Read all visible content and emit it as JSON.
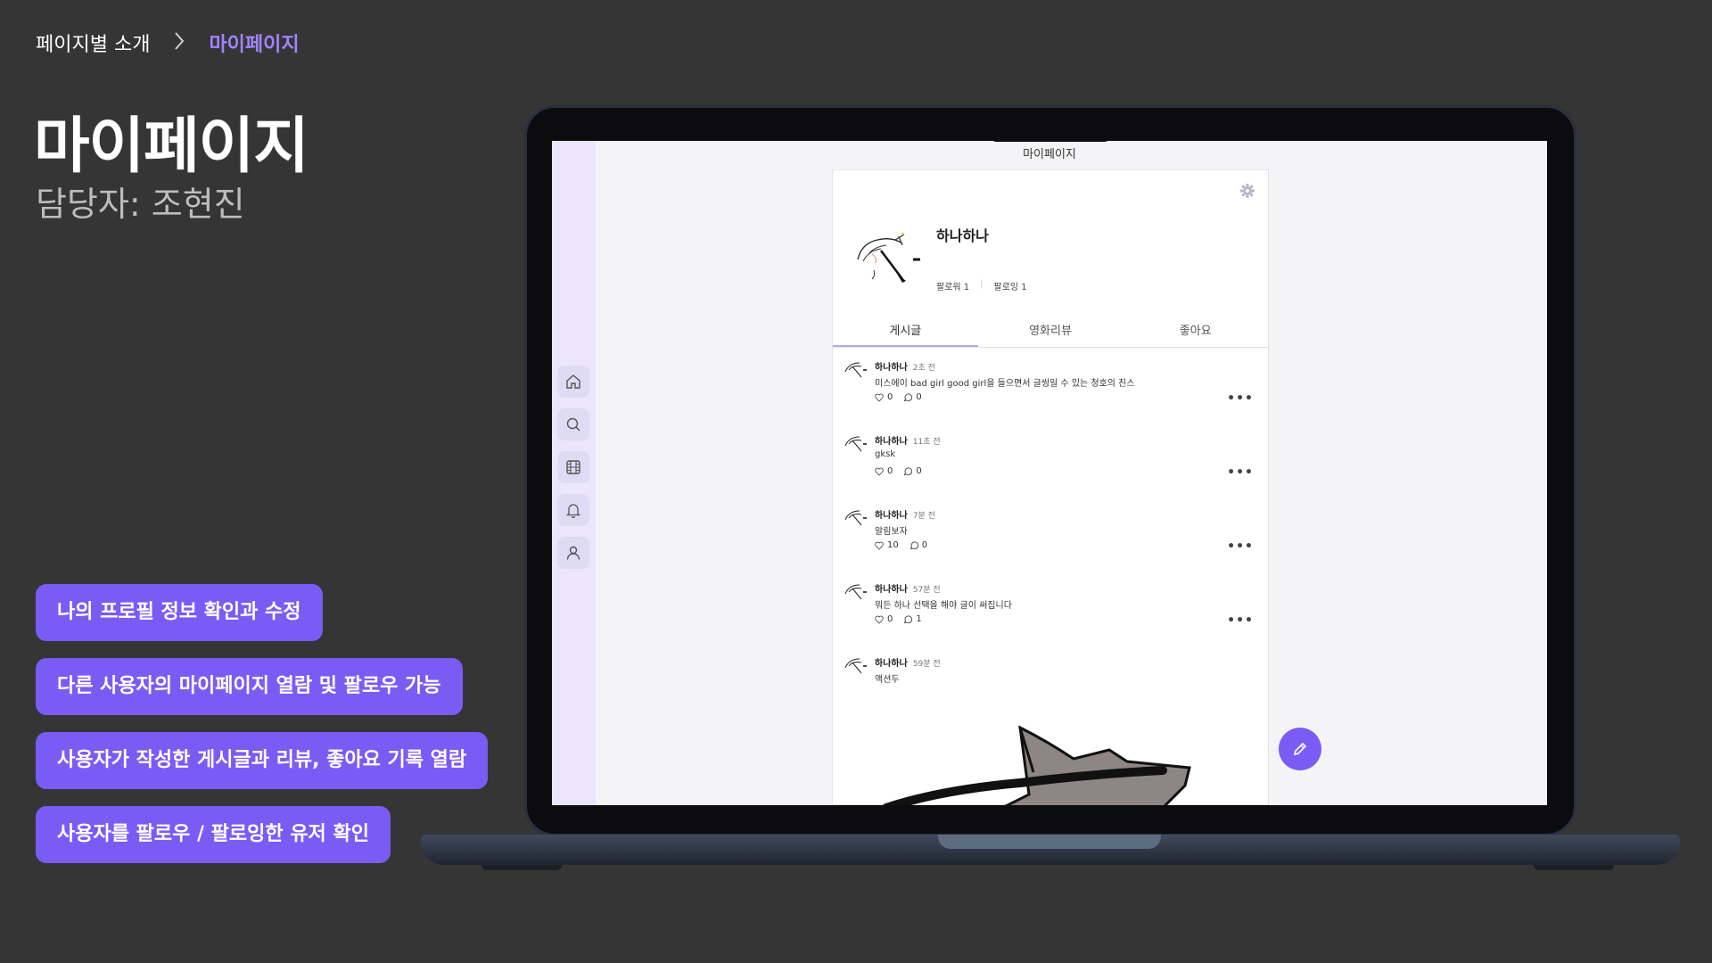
{
  "breadcrumb": {
    "parent": "페이지별 소개",
    "separator": ">",
    "current": "마이페이지"
  },
  "page": {
    "title": "마이페이지",
    "subtitle": "담당자: 조현진"
  },
  "features": [
    "나의 프로필 정보 확인과 수정",
    "다른 사용자의 마이페이지 열람 및 팔로우 가능",
    "사용자가 작성한 게시글과 리뷰, 좋아요 기록 열람",
    "사용자를 팔로우 / 팔로잉한 유저 확인"
  ],
  "app": {
    "header_title": "마이페이지",
    "sidebar": [
      "home-icon",
      "search-icon",
      "film-icon",
      "bell-icon",
      "user-icon"
    ],
    "profile": {
      "name": "하나하나",
      "followers": "팔로워 1",
      "following": "팔로잉 1"
    },
    "tabs": [
      "게시글",
      "영화리뷰",
      "좋아요"
    ],
    "active_tab": "게시글",
    "posts": [
      {
        "author": "하나하나",
        "time": "2초 전",
        "text": "미스에이 bad girl good girl을 들으면서 글씽일 수 있는 청호의 친스",
        "likes": "0",
        "comments": "0"
      },
      {
        "author": "하나하나",
        "time": "11초 전",
        "text": "gksk",
        "likes": "0",
        "comments": "0"
      },
      {
        "author": "하나하나",
        "time": "7분 전",
        "text": "알림보자",
        "likes": "10",
        "comments": "0"
      },
      {
        "author": "하나하나",
        "time": "57분 전",
        "text": "뭐든 하나 선택을 해야 글이 써집니다",
        "likes": "0",
        "comments": "1"
      },
      {
        "author": "하나하나",
        "time": "59분 전",
        "text": "액션두"
      }
    ],
    "colors": {
      "accent": "#7a5cf5",
      "breadcrumb_active": "#9f85ff",
      "background": "#353535"
    }
  }
}
